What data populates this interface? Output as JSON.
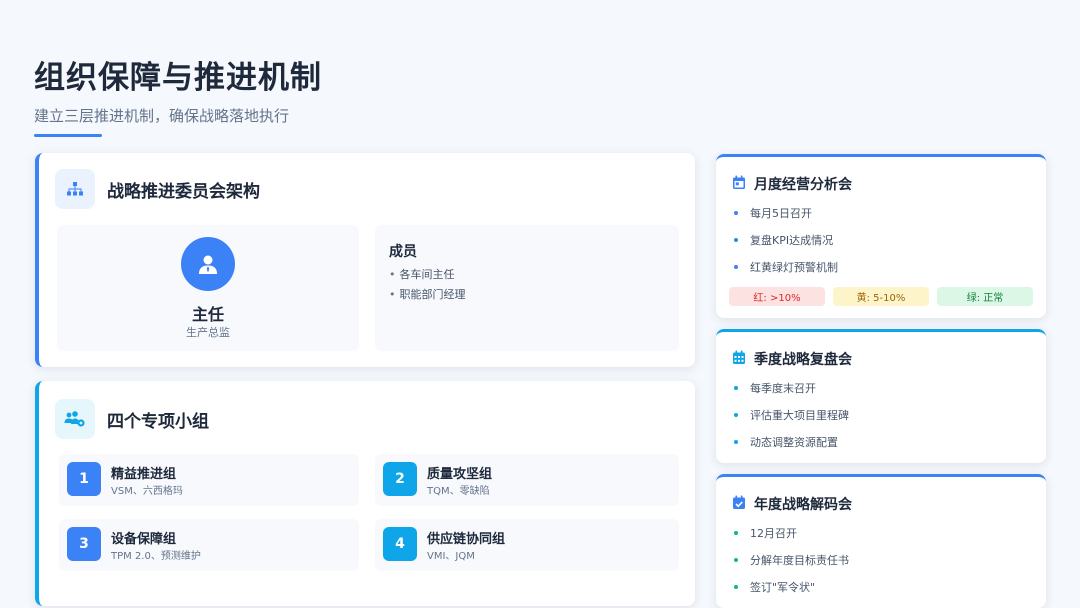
{
  "header": {
    "title": "组织保障与推进机制",
    "subtitle": "建立三层推进机制，确保战略落地执行"
  },
  "committee": {
    "title": "战略推进委员会架构",
    "icon": "org-chart-icon",
    "director": {
      "title": "主任",
      "subtitle": "生产总监",
      "icon": "user-tie-icon"
    },
    "members": {
      "title": "成员",
      "items": [
        "各车间主任",
        "职能部门经理"
      ]
    }
  },
  "groups": {
    "title": "四个专项小组",
    "icon": "users-cog-icon",
    "items": [
      {
        "num": "1",
        "name": "精益推进组",
        "tags": "VSM、六西格玛",
        "color": "#3b82f6"
      },
      {
        "num": "2",
        "name": "质量攻坚组",
        "tags": "TQM、零缺陷",
        "color": "#0ea5e9"
      },
      {
        "num": "3",
        "name": "设备保障组",
        "tags": "TPM 2.0、预测维护",
        "color": "#3b82f6"
      },
      {
        "num": "4",
        "name": "供应链协同组",
        "tags": "VMI、JQM",
        "color": "#0ea5e9"
      }
    ]
  },
  "meetings": [
    {
      "title": "月度经营分析会",
      "icon": "calendar-day-icon",
      "items": [
        "每月5日召开",
        "复盘KPI达成情况",
        "红黄绿灯预警机制"
      ],
      "dot_color": "blue",
      "tags": [
        {
          "label": "红: >10%",
          "bg": "#fde2e2",
          "fg": "#dc2626"
        },
        {
          "label": "黄: 5-10%",
          "bg": "#fdf5c9",
          "fg": "#a16207"
        },
        {
          "label": "绿: 正常",
          "bg": "#dcf7e6",
          "fg": "#15803d"
        }
      ]
    },
    {
      "title": "季度战略复盘会",
      "icon": "calendar-grid-icon",
      "items": [
        "每季度末召开",
        "评估重大项目里程碑",
        "动态调整资源配置"
      ],
      "dot_color": "teal"
    },
    {
      "title": "年度战略解码会",
      "icon": "calendar-check-icon",
      "items": [
        "12月召开",
        "分解年度目标责任书",
        "签订\"军令状\""
      ],
      "dot_color": "blue"
    }
  ],
  "colors": {
    "primary": "#3b82f6",
    "teal": "#0ea5e9"
  }
}
